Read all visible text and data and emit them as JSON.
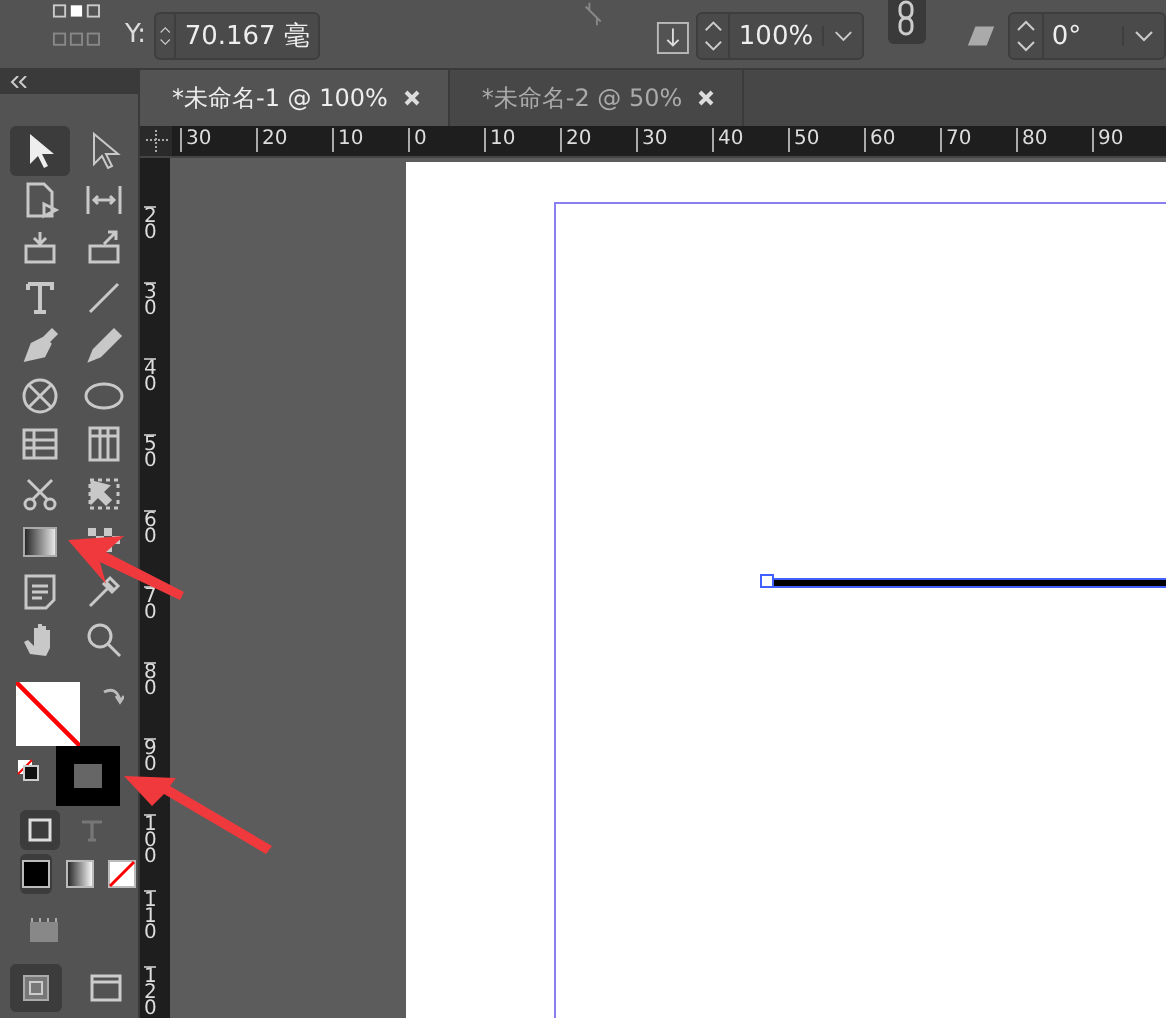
{
  "control_bar": {
    "y_label": "Y:",
    "y_value": "70.167 毫",
    "scale": "100%",
    "angle": "0°"
  },
  "tabs": [
    {
      "label": "*未命名-1  @ 100%",
      "selected": true
    },
    {
      "label": "*未命名-2  @ 50%",
      "selected": false
    }
  ],
  "tools": [
    {
      "kind": "selection",
      "selected": true
    },
    {
      "kind": "direct-selection",
      "selected": false
    },
    {
      "kind": "page",
      "selected": false
    },
    {
      "kind": "gap",
      "selected": false
    },
    {
      "kind": "collector",
      "selected": false
    },
    {
      "kind": "placer",
      "selected": false
    },
    {
      "kind": "type",
      "selected": false
    },
    {
      "kind": "line",
      "selected": false
    },
    {
      "kind": "pen",
      "selected": false
    },
    {
      "kind": "pencil",
      "selected": false
    },
    {
      "kind": "frame",
      "selected": false
    },
    {
      "kind": "ellipse",
      "selected": false
    },
    {
      "kind": "rows",
      "selected": false
    },
    {
      "kind": "columns",
      "selected": false
    },
    {
      "kind": "scissors",
      "selected": false
    },
    {
      "kind": "transform",
      "selected": false
    },
    {
      "kind": "gradient",
      "selected": false
    },
    {
      "kind": "feather",
      "selected": false
    },
    {
      "kind": "note",
      "selected": false
    },
    {
      "kind": "eyedropper",
      "selected": false
    },
    {
      "kind": "hand",
      "selected": false
    },
    {
      "kind": "zoom",
      "selected": false
    }
  ],
  "formatting": [
    {
      "kind": "container",
      "selected": true
    },
    {
      "kind": "text",
      "selected": false
    }
  ],
  "apply": [
    {
      "kind": "color",
      "selected": true
    },
    {
      "kind": "gradient",
      "selected": false
    },
    {
      "kind": "none",
      "selected": false
    }
  ],
  "ruler_h": [
    "30",
    "20",
    "10",
    "0",
    "10",
    "20",
    "30",
    "40",
    "50",
    "60",
    "70",
    "80",
    "90"
  ],
  "ruler_v": [
    "20",
    "30",
    "40",
    "50",
    "60",
    "70",
    "80",
    "90",
    "100",
    "110",
    "120"
  ]
}
